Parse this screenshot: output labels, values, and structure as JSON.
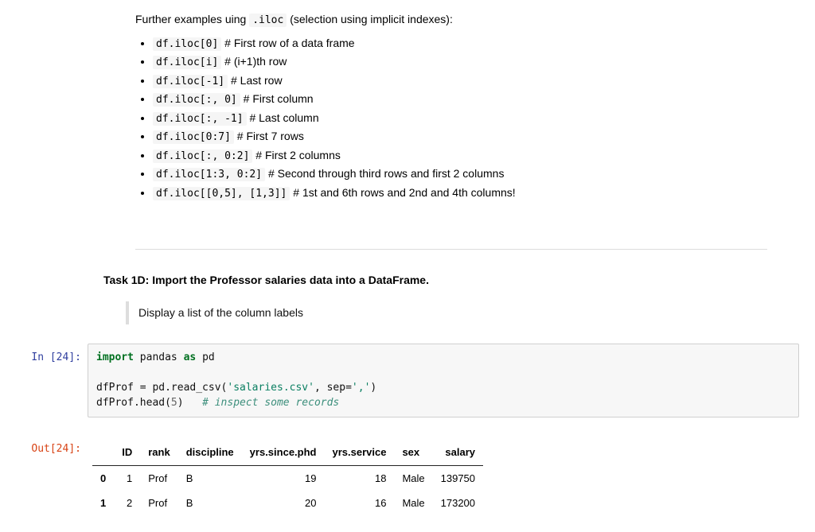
{
  "intro": {
    "prefix": "Further examples uing ",
    "code": ".iloc",
    "suffix": " (selection using implicit indexes):"
  },
  "examples": [
    {
      "code": "df.iloc[0]",
      "desc": " # First row of a data frame"
    },
    {
      "code": "df.iloc[i]",
      "desc": " # (i+1)th row"
    },
    {
      "code": "df.iloc[-1]",
      "desc": " # Last row"
    },
    {
      "code": "df.iloc[:, 0]",
      "desc": " # First column"
    },
    {
      "code": "df.iloc[:, -1]",
      "desc": " # Last column"
    },
    {
      "code": "df.iloc[0:7]",
      "desc": " # First 7 rows"
    },
    {
      "code": "df.iloc[:, 0:2]",
      "desc": " # First 2 columns"
    },
    {
      "code": "df.iloc[1:3, 0:2]",
      "desc": " # Second through third rows and first 2 columns"
    },
    {
      "code": "df.iloc[[0,5], [1,3]]",
      "desc": " # 1st and 6th rows and 2nd and 4th columns!"
    }
  ],
  "task_title": "Task 1D: Import the Professor salaries data into a DataFrame.",
  "task_note": "Display a list of the column labels",
  "cell": {
    "in_label": "In [24]:",
    "out_label": "Out[24]:",
    "code": {
      "kw_import": "import",
      "mod": "pandas",
      "kw_as": "as",
      "alias": "pd",
      "line2a": "dfProf = pd.read_csv(",
      "str_file": "'salaries.csv'",
      "line2b": ", sep=",
      "str_sep": "','",
      "line2c": ")",
      "line3a": "dfProf.head(",
      "num5": "5",
      "line3b": ")   ",
      "cmt": "# inspect some records"
    }
  },
  "table": {
    "headers": [
      "ID",
      "rank",
      "discipline",
      "yrs.since.phd",
      "yrs.service",
      "sex",
      "salary"
    ],
    "rows": [
      {
        "idx": "0",
        "cells": [
          "1",
          "Prof",
          "B",
          "19",
          "18",
          "Male",
          "139750"
        ]
      },
      {
        "idx": "1",
        "cells": [
          "2",
          "Prof",
          "B",
          "20",
          "16",
          "Male",
          "173200"
        ]
      }
    ]
  }
}
